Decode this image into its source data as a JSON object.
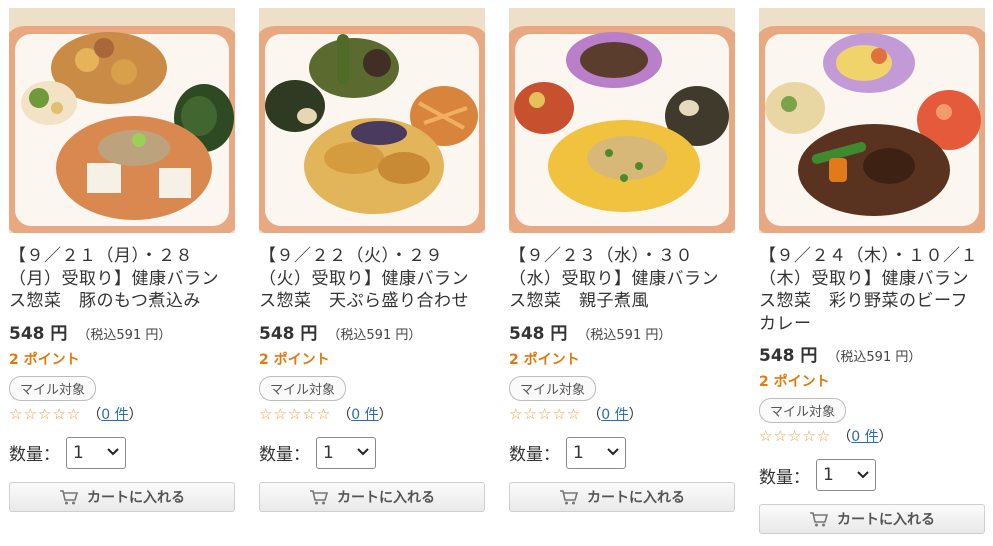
{
  "products": [
    {
      "image_alt": "bento box with motsu stew",
      "title": "【９／２１（月）・２８（月）受取り】健康バランス惣菜　豚のもつ煮込み",
      "price": "548 円",
      "tax": "（税込591 円）",
      "points": "2 ポイント",
      "mile_label": "マイル対象",
      "stars": "☆☆☆☆☆",
      "reviews_open": "（",
      "reviews_link": "0 件",
      "reviews_close": "）",
      "qty_label": "数量：",
      "qty_value": "1",
      "cart_label": "カートに入れる"
    },
    {
      "image_alt": "bento box with tempura",
      "title": "【９／２２（火）・２９（火）受取り】健康バランス惣菜　天ぷら盛り合わせ",
      "price": "548 円",
      "tax": "（税込591 円）",
      "points": "2 ポイント",
      "mile_label": "マイル対象",
      "stars": "☆☆☆☆☆",
      "reviews_open": "（",
      "reviews_link": "0 件",
      "reviews_close": "）",
      "qty_label": "数量：",
      "qty_value": "1",
      "cart_label": "カートに入れる"
    },
    {
      "image_alt": "bento box with oyakoni",
      "title": "【９／２３（水）・３０（水）受取り】健康バランス惣菜　親子煮風",
      "price": "548 円",
      "tax": "（税込591 円）",
      "points": "2 ポイント",
      "mile_label": "マイル対象",
      "stars": "☆☆☆☆☆",
      "reviews_open": "（",
      "reviews_link": "0 件",
      "reviews_close": "）",
      "qty_label": "数量：",
      "qty_value": "1",
      "cart_label": "カートに入れる"
    },
    {
      "image_alt": "bento box with beef curry",
      "title": "【９／２４（木）・１０／１（木）受取り】健康バランス惣菜　彩り野菜のビーフカレー",
      "price": "548 円",
      "tax": "（税込591 円）",
      "points": "2 ポイント",
      "mile_label": "マイル対象",
      "stars": "☆☆☆☆☆",
      "reviews_open": "（",
      "reviews_link": "0 件",
      "reviews_close": "）",
      "qty_label": "数量：",
      "qty_value": "1",
      "cart_label": "カートに入れる"
    }
  ],
  "colors": {
    "points": "#e07a0e",
    "stars": "#e9a23b",
    "link": "#2b6cb0",
    "tray": "#e8a982"
  },
  "icons": {
    "cart": "cart-icon",
    "select": "chevron-down-icon"
  }
}
